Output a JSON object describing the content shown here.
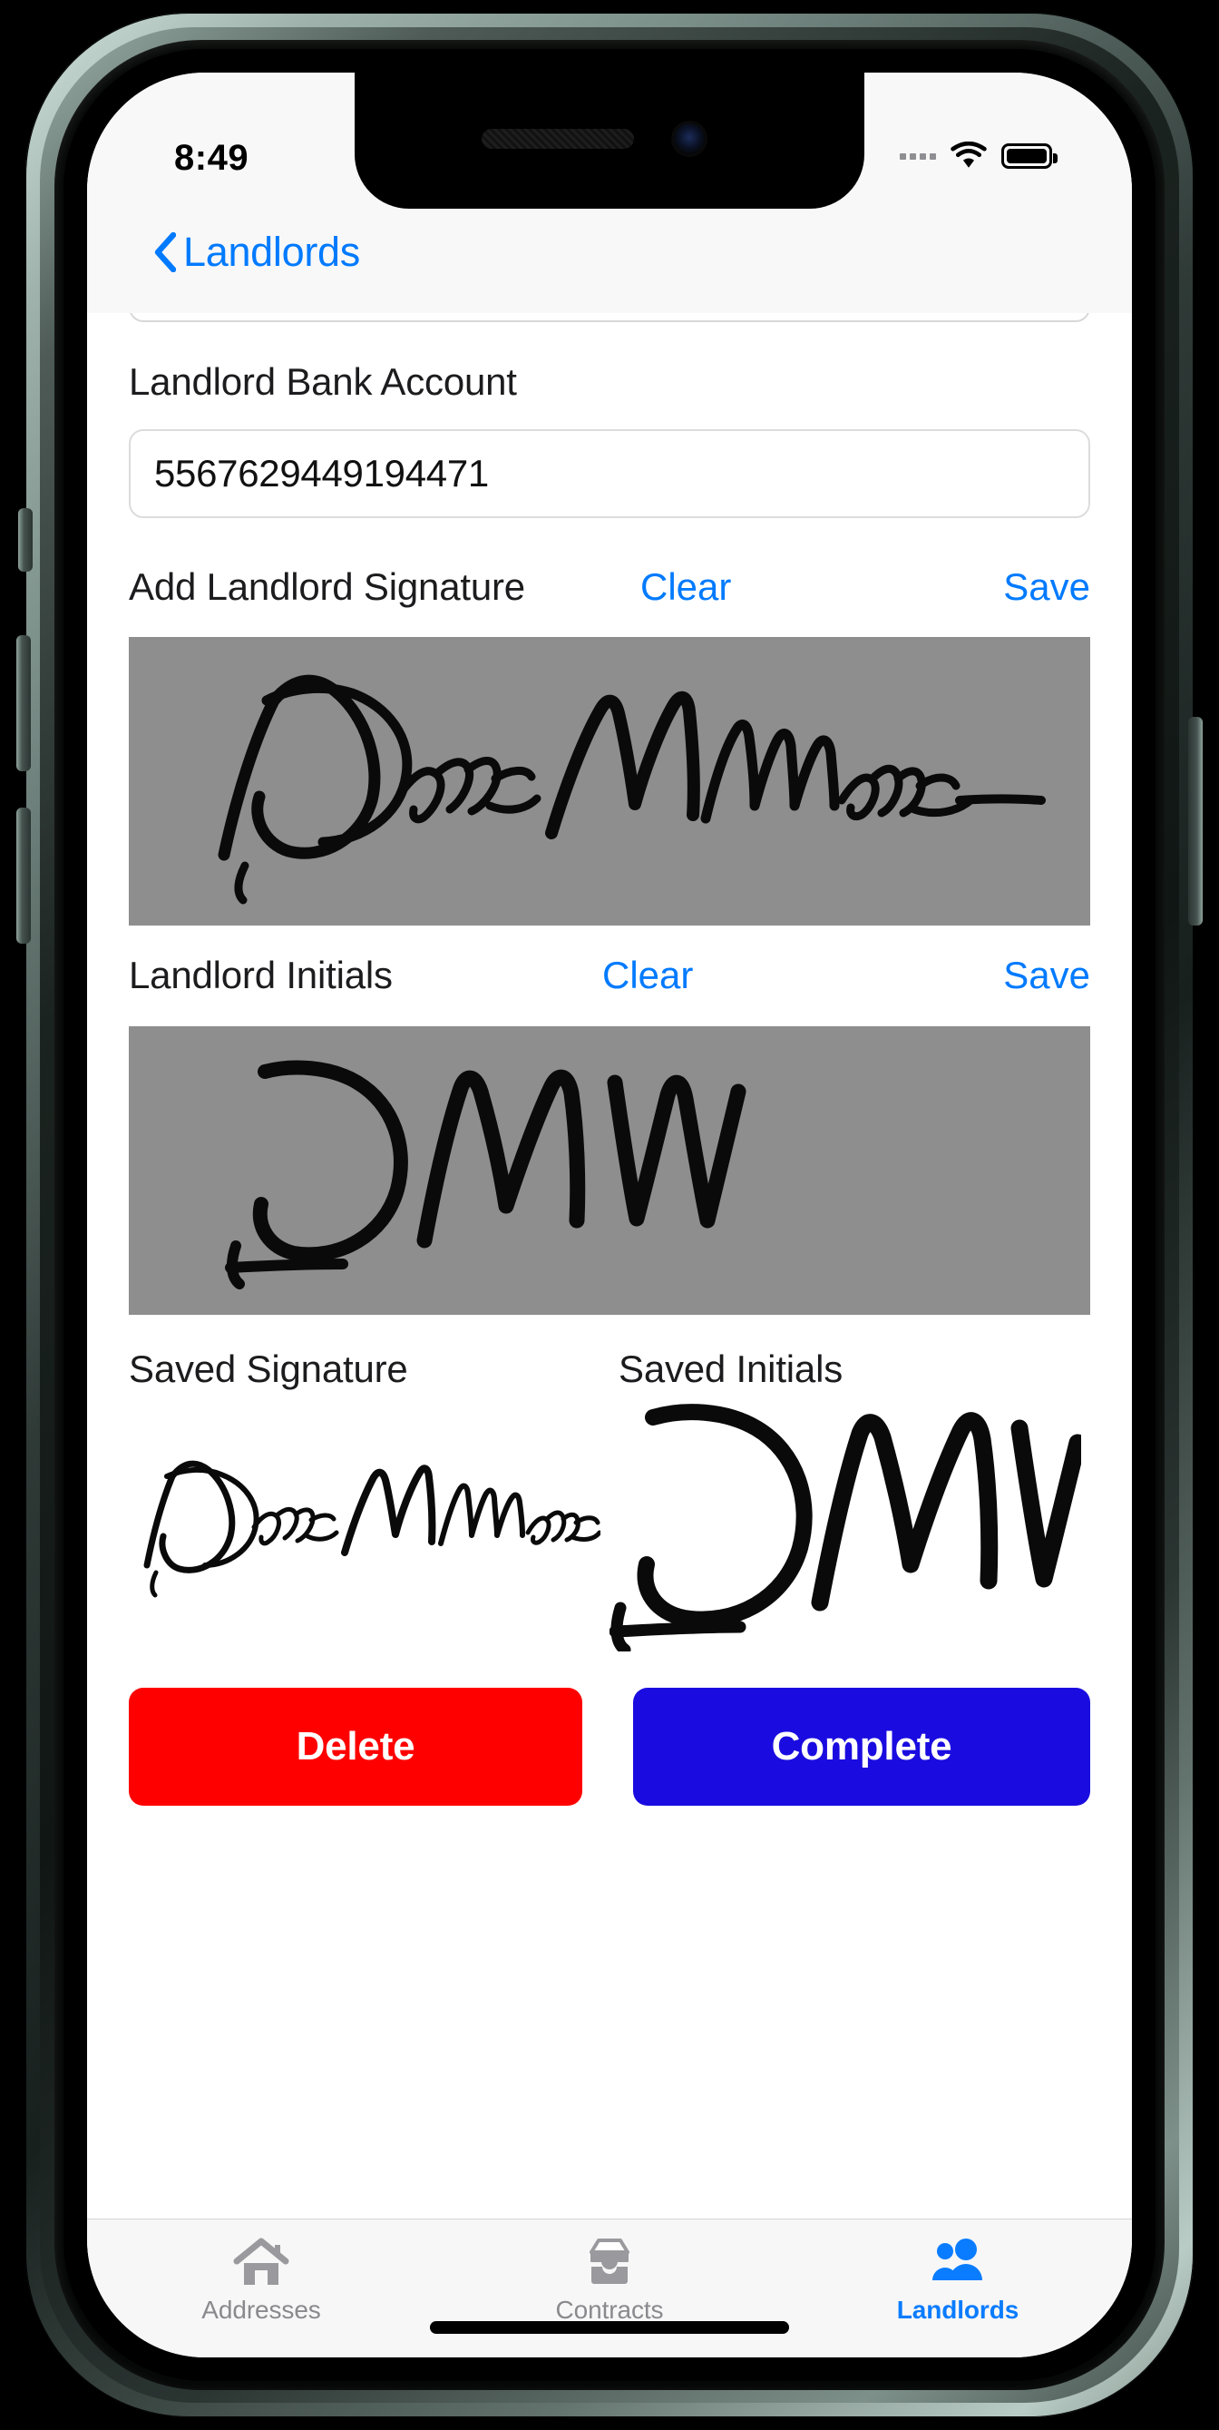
{
  "status_bar": {
    "time": "8:49",
    "signal_icon": "signal-dots-icon",
    "wifi_icon": "wifi-icon",
    "battery_icon": "battery-full-icon"
  },
  "nav_bar": {
    "back_icon": "chevron-left-icon",
    "back_label": "Landlords"
  },
  "form": {
    "bank_account": {
      "label": "Landlord Bank Account",
      "value": "5567629449194471",
      "placeholder": "Landlord Bank Account"
    },
    "signature_section": {
      "label": "Add Landlord Signature",
      "clear_label": "Clear",
      "save_label": "Save",
      "pad_name": "signature-drawing-pad",
      "pad_color": "#8e8e8e"
    },
    "initials_section": {
      "label": "Landlord Initials",
      "clear_label": "Clear",
      "save_label": "Save",
      "pad_name": "initials-drawing-pad",
      "pad_color": "#8e8e8e"
    },
    "saved": {
      "signature_label": "Saved Signature",
      "initials_label": "Saved Initials"
    }
  },
  "actions": {
    "delete": {
      "label": "Delete",
      "color": "#ff0000"
    },
    "complete": {
      "label": "Complete",
      "color": "#1a0ce0"
    }
  },
  "tab_bar": {
    "tabs": [
      {
        "label": "Addresses",
        "icon": "house-icon",
        "active": false
      },
      {
        "label": "Contracts",
        "icon": "archive-tray-icon",
        "active": false
      },
      {
        "label": "Landlords",
        "icon": "people-icon",
        "active": true
      }
    ],
    "active_color": "#0a7cff",
    "inactive_color": "#8a8a8e"
  }
}
